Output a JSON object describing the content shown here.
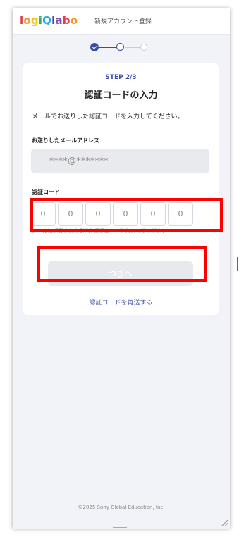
{
  "header": {
    "logo_parts": [
      {
        "text": "l",
        "color": "#e23b4b"
      },
      {
        "text": "o",
        "color": "#f39a1e"
      },
      {
        "text": "g",
        "color": "#f2c21c"
      },
      {
        "text": "i",
        "color": "#2fae5a"
      },
      {
        "text": "Q",
        "color": "#2fa3d9"
      },
      {
        "text": "l",
        "color": "#3a4da8"
      },
      {
        "text": "a",
        "color": "#8a4fb3"
      },
      {
        "text": "b",
        "color": "#e23b4b"
      },
      {
        "text": "o",
        "color": "#f39a1e"
      }
    ],
    "title": "新規アカウント登録"
  },
  "stepper": {
    "total": 3,
    "current": 2
  },
  "card": {
    "step_label": "STEP 2/3",
    "title": "認証コードの入力",
    "description": "メールでお送りした認証コードを入力してください。",
    "email_label": "お送りしたメールアドレス",
    "email_value": "****@*******",
    "code_label": "認証コード",
    "code_placeholders": [
      "0",
      "0",
      "0",
      "0",
      "0",
      "0"
    ],
    "code_hint": "メールに記載された6桁の認証コードを入力してください",
    "next_button": "つぎへ",
    "resend_link": "認証コードを再送する"
  },
  "footer": {
    "copyright": "©2025 Sony Global Education, Inc."
  },
  "colors": {
    "accent": "#3a4da8",
    "highlight": "#ff0000",
    "background": "#f2f3f8"
  }
}
